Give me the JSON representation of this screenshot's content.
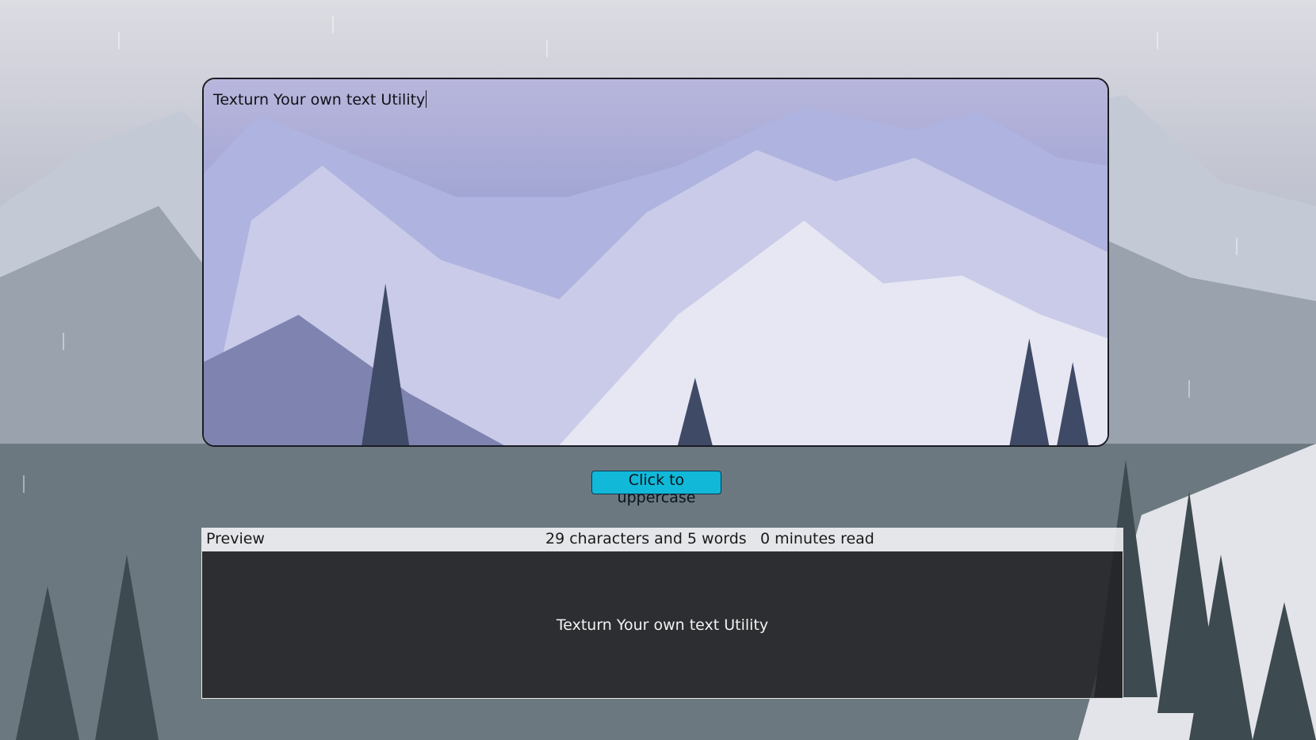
{
  "editor": {
    "value": "Texturn Your own text Utility"
  },
  "actions": {
    "uppercase_label": "Click to uppercase"
  },
  "preview": {
    "title": "Preview",
    "stats": "29 characters and 5 words",
    "read_time": "0 minutes read",
    "content": "Texturn Your own text Utility"
  },
  "colors": {
    "button": "#12b8d8",
    "preview_bg": "#222224"
  }
}
